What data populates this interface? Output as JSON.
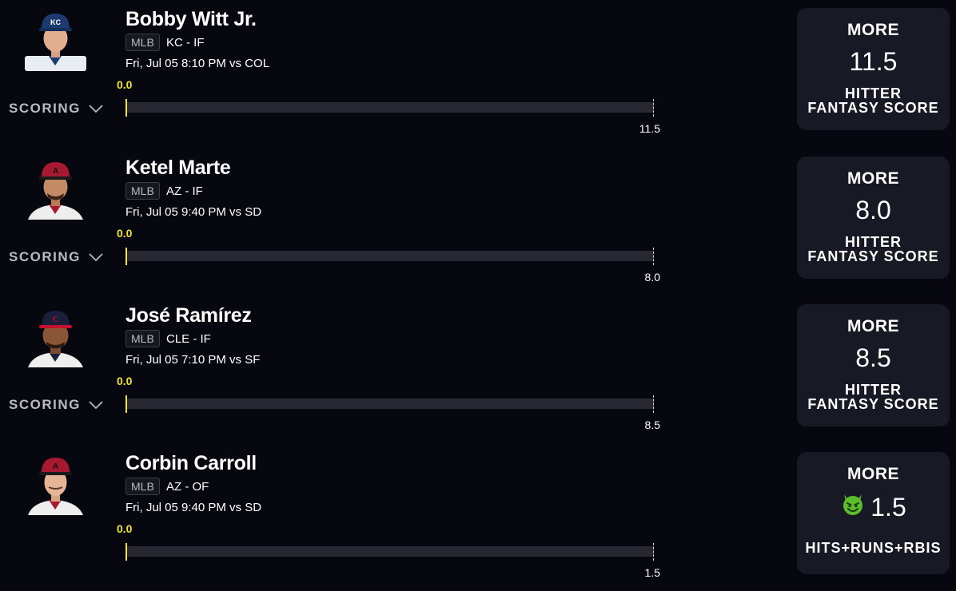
{
  "players": [
    {
      "name": "Bobby Witt Jr.",
      "league": "MLB",
      "team_pos": "KC - IF",
      "game": "Fri, Jul 05 8:10 PM  vs COL",
      "current": "0.0",
      "scoring_label": "SCORING",
      "target": "11.5",
      "progress": 0,
      "pick": {
        "direction": "MORE",
        "line": "11.5",
        "stat_line1": "HITTER",
        "stat_line2": "FANTASY SCORE",
        "demon": false
      },
      "cap_color": "#1d3b6f",
      "jersey_color": "#e8ecf3"
    },
    {
      "name": "Ketel Marte",
      "league": "MLB",
      "team_pos": "AZ - IF",
      "game": "Fri, Jul 05 9:40 PM  vs SD",
      "current": "0.0",
      "scoring_label": "SCORING",
      "target": "8.0",
      "progress": 0,
      "pick": {
        "direction": "MORE",
        "line": "8.0",
        "stat_line1": "HITTER",
        "stat_line2": "FANTASY SCORE",
        "demon": false
      },
      "cap_color": "#a71930",
      "jersey_color": "#eeeeee"
    },
    {
      "name": "José Ramírez",
      "league": "MLB",
      "team_pos": "CLE - IF",
      "game": "Fri, Jul 05 7:10 PM  vs SF",
      "current": "0.0",
      "scoring_label": "SCORING",
      "target": "8.5",
      "progress": 0,
      "pick": {
        "direction": "MORE",
        "line": "8.5",
        "stat_line1": "HITTER",
        "stat_line2": "FANTASY SCORE",
        "demon": false
      },
      "cap_color": "#1a1f3a",
      "jersey_color": "#eeeeee"
    },
    {
      "name": "Corbin Carroll",
      "league": "MLB",
      "team_pos": "AZ - OF",
      "game": "Fri, Jul 05 9:40 PM  vs SD",
      "current": "0.0",
      "scoring_label": "",
      "target": "1.5",
      "progress": 0,
      "pick": {
        "direction": "MORE",
        "line": "1.5",
        "stat_line1": "HITS+RUNS+RBIS",
        "stat_line2": "",
        "demon": true
      },
      "cap_color": "#a71930",
      "jersey_color": "#eeeeee"
    }
  ],
  "colors": {
    "background": "#07070f",
    "card": "#171924",
    "track": "#272832",
    "current_value": "#f1e42b",
    "demon": "#5bbd2b"
  }
}
